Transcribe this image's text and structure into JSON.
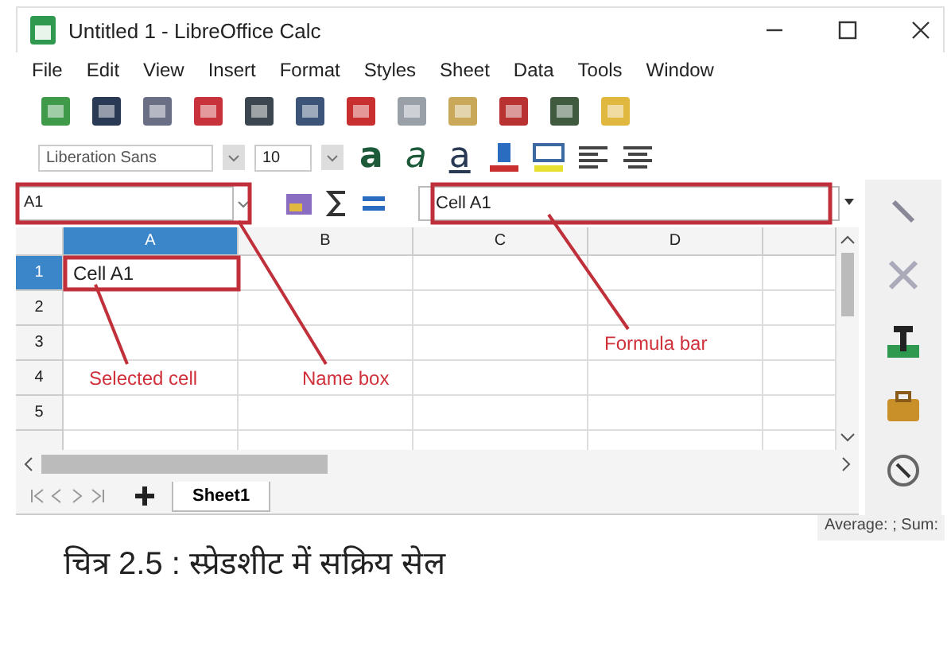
{
  "window": {
    "title": "Untitled 1 - LibreOffice Calc"
  },
  "menu": [
    "File",
    "Edit",
    "View",
    "Insert",
    "Format",
    "Styles",
    "Sheet",
    "Data",
    "Tools",
    "Window"
  ],
  "font_name": {
    "value": "Liberation Sans"
  },
  "font_size": {
    "value": "10"
  },
  "format_buttons": [
    {
      "label": "a",
      "kind": "bold"
    },
    {
      "label": "a",
      "kind": "italic"
    },
    {
      "label": "a",
      "kind": "underline"
    }
  ],
  "name_box": {
    "value": "A1"
  },
  "formula_bar": {
    "value": "Cell A1"
  },
  "columns": [
    {
      "label": "A",
      "selected": true
    },
    {
      "label": "B",
      "selected": false
    },
    {
      "label": "C",
      "selected": false
    },
    {
      "label": "D",
      "selected": false
    }
  ],
  "rows": [
    {
      "label": "1",
      "selected": true,
      "cells": [
        "Cell A1"
      ]
    },
    {
      "label": "2",
      "selected": false,
      "cells": []
    },
    {
      "label": "3",
      "selected": false,
      "cells": []
    },
    {
      "label": "4",
      "selected": false,
      "cells": []
    },
    {
      "label": "5",
      "selected": false,
      "cells": []
    }
  ],
  "annotations": [
    "Selected cell",
    "Name box",
    "Formula bar"
  ],
  "sheet_tabs": [
    {
      "label": "Sheet1",
      "selected": true
    }
  ],
  "status_bar": {
    "text": "Average: ; Sum:"
  },
  "caption": "चित्र 2.5 : स्प्रेडशीट में सक्रिय सेल"
}
